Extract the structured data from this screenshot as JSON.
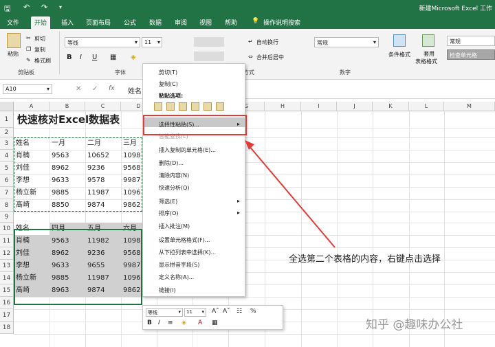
{
  "title_bar": {
    "save_icon": "save-icon",
    "undo_icon": "undo-icon",
    "redo_icon": "redo-icon",
    "doc_title": "新建Microsoft Excel 工作"
  },
  "tabs": [
    "文件",
    "开始",
    "插入",
    "页面布局",
    "公式",
    "数据",
    "审阅",
    "视图",
    "帮助",
    "操作说明搜索"
  ],
  "ribbon": {
    "paste": "粘贴",
    "cut": "剪切",
    "copy": "复制",
    "format_painter": "格式刷",
    "clipboard": "剪贴板",
    "font_name": "等线",
    "font_size": "11",
    "font_group": "字体",
    "wrap": "自动换行",
    "merge": "合并后居中",
    "align_group": "方式",
    "number_format": "常规",
    "number_group": "数字",
    "cond_format": "条件格式",
    "table_format_1": "套用",
    "table_format_2": "表格格式",
    "style_normal": "常规",
    "style_check": "检查单元格",
    "bold": "B",
    "italic": "I",
    "underline": "U"
  },
  "formula_bar": {
    "name_box": "A10",
    "value": "姓名"
  },
  "columns": [
    "A",
    "B",
    "C",
    "D",
    "E",
    "F",
    "G",
    "H",
    "I",
    "J",
    "K",
    "L",
    "M"
  ],
  "rows": [
    "1",
    "2",
    "3",
    "4",
    "5",
    "6",
    "7",
    "8",
    "9",
    "10",
    "11",
    "12",
    "13",
    "14",
    "15",
    "16",
    "17",
    "18"
  ],
  "sheet": {
    "title": "快速核对Excel数据表",
    "table1": [
      [
        "姓名",
        "一月",
        "二月",
        "三月"
      ],
      [
        "肖楠",
        "9563",
        "10652",
        "1098"
      ],
      [
        "刘佳",
        "8962",
        "9236",
        "9568"
      ],
      [
        "李想",
        "9633",
        "9578",
        "9987"
      ],
      [
        "杨立新",
        "9885",
        "11987",
        "1096"
      ],
      [
        "高崎",
        "8850",
        "9874",
        "9862"
      ]
    ],
    "table2": [
      [
        "姓名",
        "四月",
        "五月",
        "六月"
      ],
      [
        "肖楠",
        "9563",
        "11982",
        "1098"
      ],
      [
        "刘佳",
        "8962",
        "9236",
        "9568"
      ],
      [
        "李想",
        "9633",
        "9655",
        "9987"
      ],
      [
        "杨立新",
        "9885",
        "11987",
        "1096"
      ],
      [
        "高崎",
        "8963",
        "9874",
        "9862"
      ]
    ]
  },
  "context_menu": {
    "items": [
      "剪切(T)",
      "复制(C)",
      "粘贴选项:",
      "选择性粘贴(S)...",
      "智能查找(L)",
      "插入复制的单元格(E)...",
      "删除(D)...",
      "清除内容(N)",
      "快速分析(Q)",
      "筛选(E)",
      "排序(O)",
      "插入批注(M)",
      "设置单元格格式(F)...",
      "从下拉列表中选择(K)...",
      "显示拼音字段(S)",
      "定义名称(A)...",
      "链接(I)"
    ],
    "submenu_arrow": "▸"
  },
  "mini_toolbar": {
    "font": "等线",
    "size": "11",
    "percent": "%"
  },
  "annotation": "全选第二个表格的内容，右键点击选择",
  "watermark": "知乎 @趣味办公社"
}
